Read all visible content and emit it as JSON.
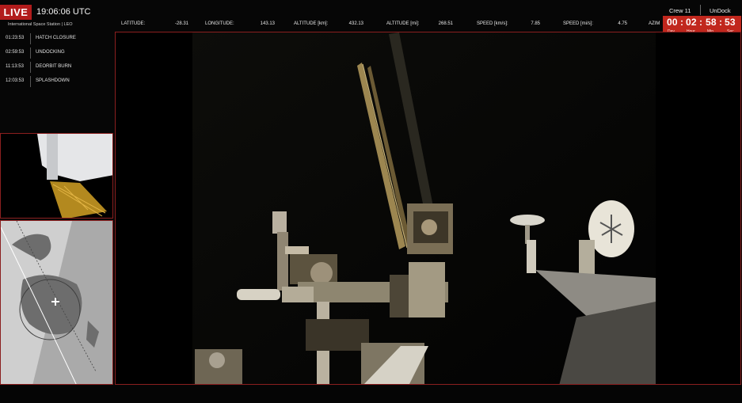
{
  "live_badge": "LIVE",
  "clock": "19:06:06 UTC",
  "station": "International Space Station | LEO",
  "events": [
    {
      "time": "01:23:53",
      "name": "HATCH CLOSURE"
    },
    {
      "time": "02:59:53",
      "name": "UNDOCKING"
    },
    {
      "time": "11:13:53",
      "name": "DEORBIT BURN"
    },
    {
      "time": "12:03:53",
      "name": "SPLASHDOWN"
    }
  ],
  "telemetry": [
    {
      "label": "LATITUDE:",
      "value": "-28.31"
    },
    {
      "label": "LONGITUDE:",
      "value": "143.13"
    },
    {
      "label": "ALTITUDE [km]:",
      "value": "432.13"
    },
    {
      "label": "ALTITUDE [mi]:",
      "value": "268.51"
    },
    {
      "label": "SPEED [km/s]:",
      "value": "7.85"
    },
    {
      "label": "SPEED [mi/s]:",
      "value": "4.75"
    },
    {
      "label": "AZIM",
      "value": ""
    }
  ],
  "countdown": {
    "crew": "Crew 11",
    "mission": "UnDock",
    "day": "00",
    "hour": "02",
    "min": "58",
    "sec": "53",
    "units": [
      "Day",
      "Hour",
      "Min",
      "Sec"
    ],
    "color": "#c1271d"
  },
  "colors": {
    "accent": "#b21c1c",
    "frame_border": "#8b1f1f",
    "map_land": "#6d6d6d",
    "map_water": "#cfcfcf"
  }
}
